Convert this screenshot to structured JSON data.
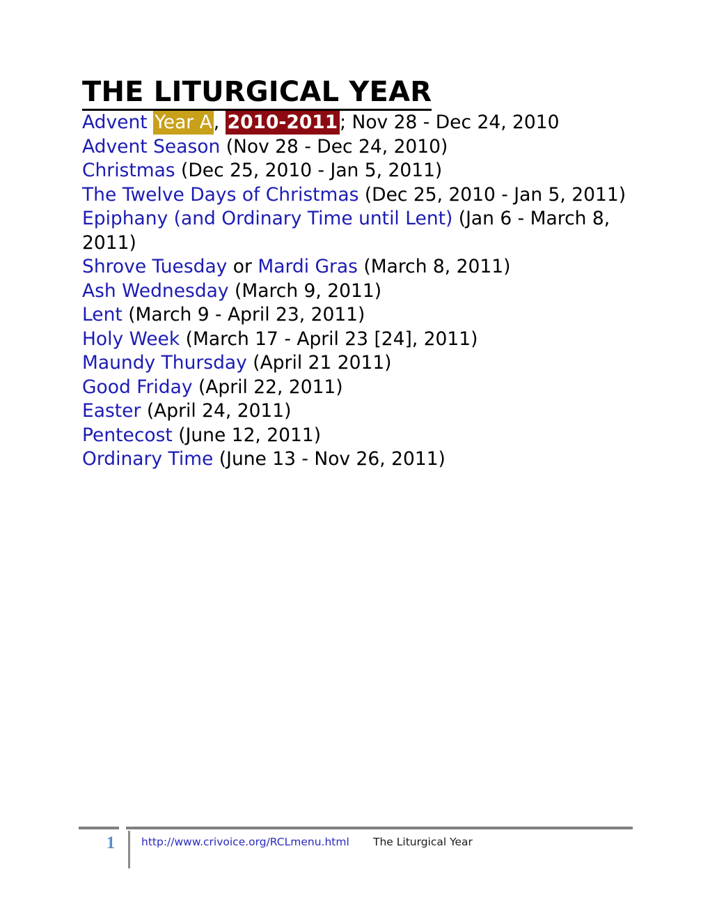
{
  "document": {
    "title": "THE LITURGICAL YEAR"
  },
  "colors": {
    "link_blue": "#1c1cb4",
    "highlight_gold": "#c8a01a",
    "highlight_red": "#8c0b12",
    "footer_rule_gray": "#808080",
    "page_number_blue": "#5b8bc4"
  },
  "entries": {
    "advent_line": {
      "link_label": "Advent",
      "year_badge": "Year A",
      "comma": ",",
      "season_badge": "2010-2011",
      "dates": "; Nov 28 - Dec 24, 2010"
    },
    "advent_season": {
      "link_label": "Advent Season",
      "dates": " (Nov 28 - Dec 24, 2010)"
    },
    "christmas": {
      "link_label": "Christmas",
      "dates": " (Dec 25, 2010 - Jan 5, 2011)"
    },
    "twelve_days": {
      "link_label": "The Twelve Days of Christmas",
      "dates": " (Dec 25, 2010 - Jan 5, 2011)"
    },
    "epiphany": {
      "link_label": "Epiphany (and Ordinary Time until Lent)",
      "dates": " (Jan 6 - March 8, 2011)"
    },
    "shrove_tuesday": {
      "link_label": "Shrove Tuesday",
      "conjunction": " or ",
      "alt_link_label": "Mardi Gras",
      "dates": " (March 8, 2011)"
    },
    "ash_wednesday": {
      "link_label": "Ash Wednesday",
      "dates": " (March 9, 2011)"
    },
    "lent": {
      "link_label": "Lent",
      "dates": " (March 9 - April 23, 2011)"
    },
    "holy_week": {
      "link_label": "Holy Week",
      "dates": " (March 17 - April 23 [24], 2011)"
    },
    "maundy_thursday": {
      "link_label": "Maundy Thursday",
      "dates": " (April 21 2011)"
    },
    "good_friday": {
      "link_label": "Good Friday",
      "dates": " (April 22, 2011)"
    },
    "easter": {
      "link_label": "Easter",
      "dates": " (April 24, 2011)"
    },
    "pentecost": {
      "link_label": "Pentecost",
      "dates": " (June 12, 2011)"
    },
    "ordinary_time": {
      "link_label": "Ordinary Time",
      "dates": " (June 13 - Nov 26, 2011)"
    }
  },
  "footer": {
    "page_number": "1",
    "url": "http://www.crivoice.org/RCLmenu.html",
    "document_name": "The Liturgical Year"
  }
}
